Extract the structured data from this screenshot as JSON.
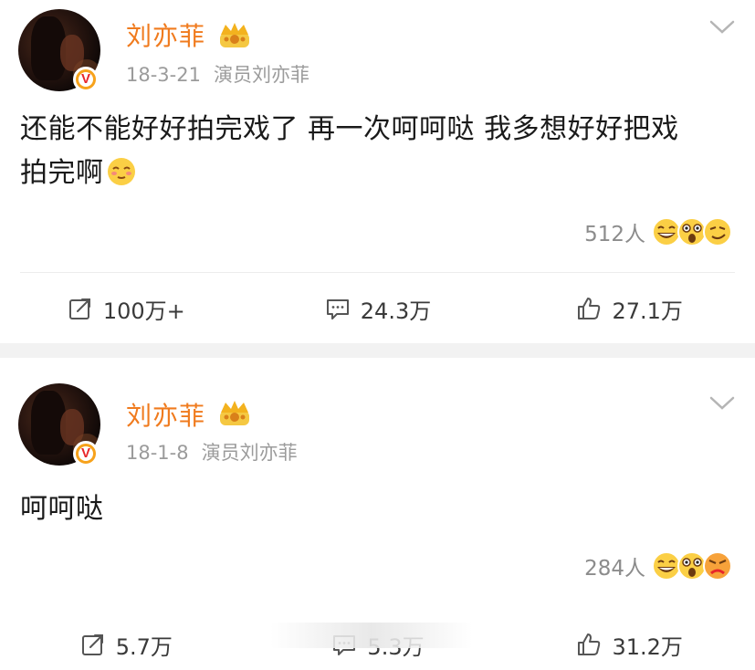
{
  "posts": [
    {
      "author": "刘亦菲",
      "date": "18-3-21",
      "source": "演员刘亦菲",
      "content_line1": "还能不能好好拍完戏了 再一次呵呵哒 我多想好好把戏",
      "content_line2": "拍完啊",
      "reaction_count": "512人",
      "repost": "100万+",
      "comments": "24.3万",
      "likes": "27.1万"
    },
    {
      "author": "刘亦菲",
      "date": "18-1-8",
      "source": "演员刘亦菲",
      "content_line1": "呵呵哒",
      "reaction_count": "284人",
      "repost": "5.7万",
      "comments": "5.3万",
      "likes": "31.2万"
    }
  ],
  "badge_letter": "V",
  "colors": {
    "author_name": "#f07b1e",
    "verified_badge": "#f7a21b",
    "meta_gray": "#9b9b9b",
    "separator": "#f2f2f2"
  },
  "icons": [
    "crown-icon",
    "chevron-down-icon",
    "verified-v-icon",
    "repost-icon",
    "comment-icon",
    "like-icon",
    "emoji-laugh-icon",
    "emoji-surprise-icon",
    "emoji-smirk-icon"
  ]
}
